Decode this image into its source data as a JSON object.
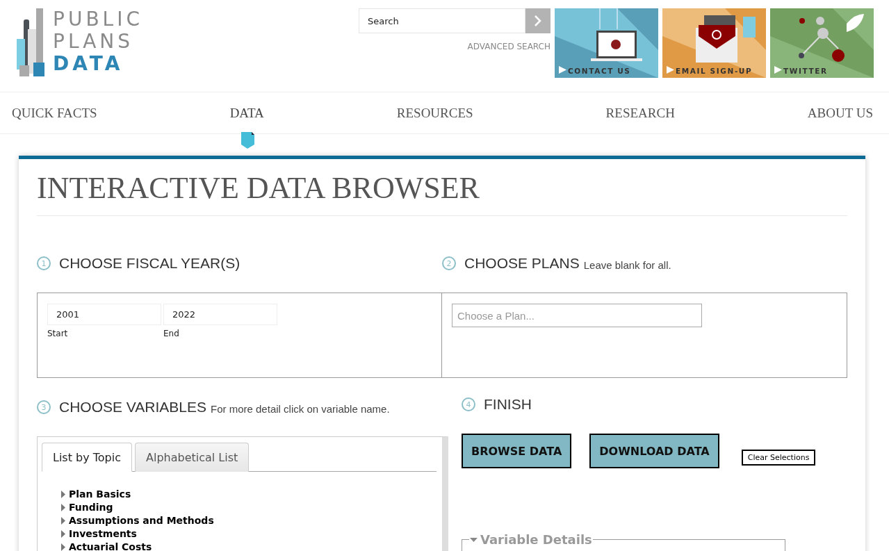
{
  "logo": {
    "line1": "PUBLIC",
    "line2": "PLANS",
    "line3": "DATA"
  },
  "search": {
    "placeholder": "Search",
    "advanced": "ADVANCED SEARCH"
  },
  "promos": [
    {
      "label": "CONTACT US",
      "kind": "laptop"
    },
    {
      "label": "EMAIL SIGN-UP",
      "kind": "email"
    },
    {
      "label": "TWITTER",
      "kind": "network"
    }
  ],
  "nav": [
    {
      "label": "QUICK FACTS",
      "selected": false
    },
    {
      "label": "DATA",
      "selected": true
    },
    {
      "label": "RESOURCES",
      "selected": false
    },
    {
      "label": "RESEARCH",
      "selected": false
    },
    {
      "label": "ABOUT US",
      "selected": false
    }
  ],
  "title": "INTERACTIVE DATA BROWSER",
  "step1": {
    "number": "1",
    "heading": "CHOOSE FISCAL YEAR(S)",
    "start": {
      "value": "2001",
      "label": "Start"
    },
    "end": {
      "value": "2022",
      "label": "End"
    }
  },
  "step2": {
    "number": "2",
    "heading": "CHOOSE PLANS",
    "note": "Leave blank for all.",
    "placeholder": "Choose a Plan..."
  },
  "step3": {
    "number": "3",
    "heading": "CHOOSE VARIABLES",
    "note": "For more detail click on variable name.",
    "tabs": [
      {
        "label": "List by Topic",
        "selected": true
      },
      {
        "label": "Alphabetical List",
        "selected": false
      }
    ],
    "topics": [
      {
        "label": "Plan Basics",
        "expanded": false
      },
      {
        "label": "Funding",
        "expanded": false
      },
      {
        "label": "Assumptions and Methods",
        "expanded": false
      },
      {
        "label": "Investments",
        "expanded": false
      },
      {
        "label": "Actuarial Costs",
        "expanded": false
      }
    ]
  },
  "step4": {
    "number": "4",
    "heading": "FINISH",
    "buttons": [
      "BROWSE DATA",
      "DOWNLOAD DATA"
    ],
    "clear": "Clear Selections"
  },
  "details": {
    "legend": "Variable Details",
    "expanded": true
  }
}
